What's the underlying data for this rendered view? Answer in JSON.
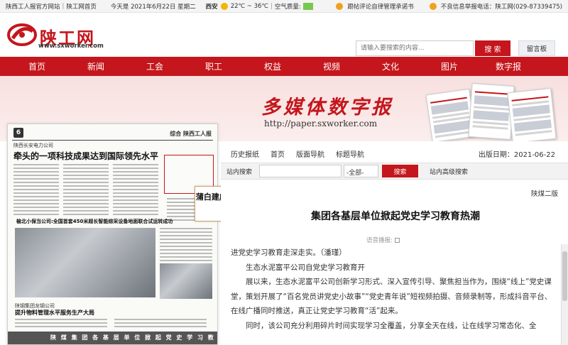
{
  "topbar": {
    "links": [
      "陕西工人报官方网站",
      "陕工网首页"
    ],
    "date": "今天是 2021年6月22日 星期二",
    "city": "西安",
    "temp": "22℃ ~ 36℃",
    "air": "空气质量:",
    "report1": "跟帖评论自律管理承诺书",
    "report2": "不良信息举报电话：陕工网(029-87339475)"
  },
  "header": {
    "logo_text": "陕工网",
    "logo_url": "www.sxworker.com",
    "search_placeholder": "请输入要搜索的内容...",
    "search_btn": "搜 索",
    "message_btn": "留言板"
  },
  "nav": [
    "首页",
    "新闻",
    "工会",
    "职工",
    "权益",
    "视频",
    "文化",
    "图片",
    "数字报"
  ],
  "banner": {
    "title": "多媒体数字报",
    "url": "http://paper.sxworker.com"
  },
  "newspaper": {
    "page_no": "6",
    "section": "综合 陕西工人报",
    "subhead": "陕西长安电力公司",
    "headline": "牵头的一项科技成果达到国际领先水平",
    "head2": "榆北小保当公司:全国首套450米超长智能综采设备地面联合试运转成功",
    "head3": "陕钢集团龙钢公司",
    "head4": "提升物料管理水平服务生产大局",
    "footer": "陕 煤 集 团 各 基 层 单 位 掀 起 党 史 学 习 教 育 热 潮"
  },
  "tooltip": "蒲白建庄矿业综采队获“陕西省工人先锋号”殊荣",
  "panel": {
    "nav": [
      "历史报纸",
      "首页",
      "版面导航",
      "标题导航"
    ],
    "date": "出版日期：2021-06-22",
    "search_label": "站内搜索",
    "scope": "-全部-",
    "search_btn": "搜索",
    "advanced": "站内高级搜索",
    "edition": "陕煤二版",
    "title": "集团各基层单位掀起党史学习教育热潮",
    "voice": "语音播报:",
    "body": [
      "进党史学习教育走深走实。（潘瑾）",
      "生态水泥富平公司自党史学习教育开",
      "展以来，生态水泥富平公司创新学习形式、深入宣传引导、聚焦担当作为，围绕“线上”党史课堂，策划开展了“百名党员讲党史小故事”“党史青年说”短视频拍摄、音频录制等，形成抖音平台、在线广播同时推送，真正让党史学习教育“活”起来。",
      "同时，该公司充分利用碎片时间实现学习全覆盖，分享全天在线，让在线学习常态化、全"
    ]
  }
}
